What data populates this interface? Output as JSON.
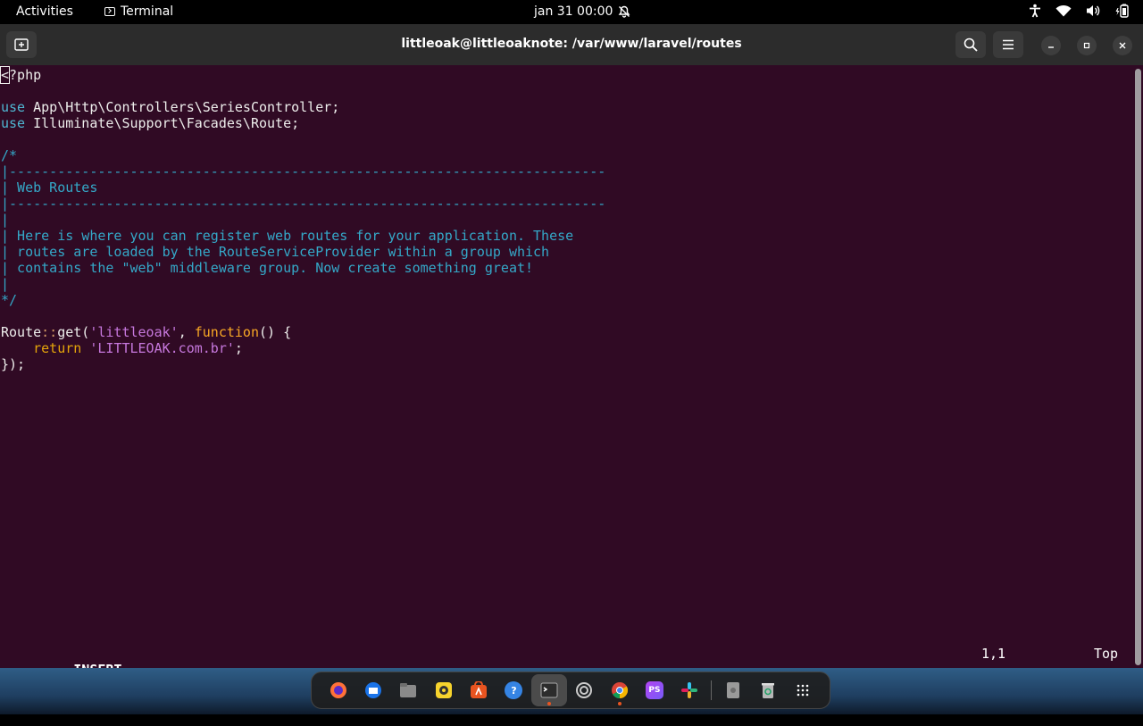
{
  "topbar": {
    "activities": "Activities",
    "app_name": "Terminal",
    "clock": "jan 31  00:00"
  },
  "window": {
    "title": "littleoak@littleoaknote: /var/www/laravel/routes"
  },
  "editor": {
    "l1_rest": "?php",
    "l1_cursor": "<",
    "use_kw": "use",
    "use1_path": " App\\Http\\Controllers\\SeriesController;",
    "use2_path": " Illuminate\\Support\\Facades\\Route;",
    "c_open": "/*",
    "c_rule": "|--------------------------------------------------------------------------",
    "c_title": "| Web Routes",
    "c_bar": "|",
    "c_l1": "| Here is where you can register web routes for your application. These",
    "c_l2": "| routes are loaded by the RouteServiceProvider within a group which",
    "c_l3": "| contains the \"web\" middleware group. Now create something great!",
    "c_close": "*/",
    "route_cls": "Route",
    "route_op": "::",
    "route_get": "get(",
    "route_str": "'littleoak'",
    "route_comma": ", ",
    "route_fn": "function",
    "route_tail": "() {",
    "ret_indent": "    ",
    "ret_kw": "return",
    "ret_str": " 'LITTLEOAK.com.br'",
    "ret_semi": ";",
    "close": "});"
  },
  "status": {
    "mode": "-- INSERT --",
    "position": "1,1",
    "scroll": "Top"
  },
  "dock": {
    "apps": [
      "firefox-icon",
      "thunderbird-icon",
      "files-icon",
      "rhythmbox-icon",
      "software-icon",
      "help-icon",
      "terminal-icon",
      "settings-icon",
      "chrome-icon",
      "phpstorm-icon",
      "slack-icon",
      "disk-icon",
      "trash-icon",
      "app-grid-icon"
    ]
  },
  "colors": {
    "terminal_bg": "#300a24",
    "headerbar_bg": "#2c2c2c",
    "accent": "#e95420"
  }
}
